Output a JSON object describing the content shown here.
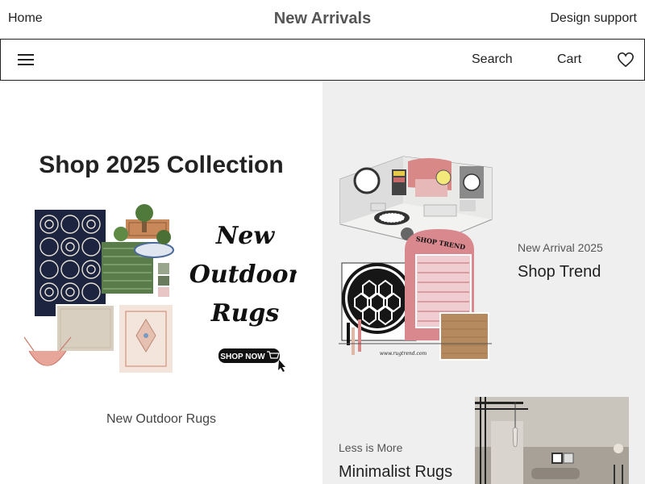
{
  "header": {
    "home": "Home",
    "title": "New Arrivals",
    "support": "Design support"
  },
  "nav": {
    "search": "Search",
    "cart": "Cart",
    "menu_icon": "hamburger-icon",
    "wishlist_icon": "heart-icon"
  },
  "left_panel": {
    "heading": "Shop 2025 Collection",
    "promo": {
      "line1": "New",
      "line2": "Outdoor",
      "line3": "Rugs",
      "cta": "SHOP NOW"
    },
    "caption": "New Outdoor Rugs"
  },
  "right_panel": {
    "feature1": {
      "eyebrow": "New Arrival 2025",
      "title": "Shop Trend",
      "image_sign": "SHOP TREND",
      "image_url_text": "www.rugtrend.com"
    },
    "feature2": {
      "eyebrow": "Less is More",
      "title": "Minimalist Rugs"
    }
  },
  "colors": {
    "right_bg": "#efefef",
    "text": "#222222",
    "muted": "#555555"
  }
}
